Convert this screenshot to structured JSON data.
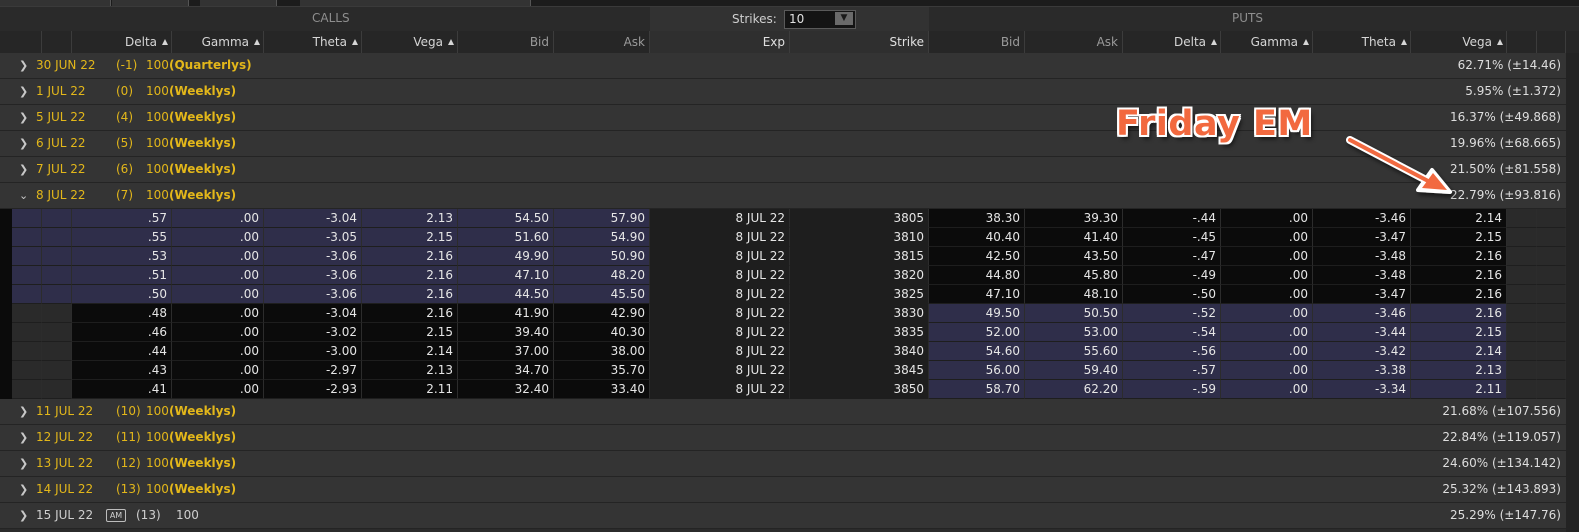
{
  "sections": {
    "calls": "CALLS",
    "puts": "PUTS",
    "strikes_label": "Strikes:",
    "strikes_value": "10"
  },
  "columns": {
    "calls": [
      "Delta",
      "Gamma",
      "Theta",
      "Vega",
      "Bid",
      "Ask"
    ],
    "middle": [
      "Exp",
      "Strike"
    ],
    "puts": [
      "Bid",
      "Ask",
      "Delta",
      "Gamma",
      "Theta",
      "Vega"
    ]
  },
  "expirations_before": [
    {
      "date": "30 JUN 22",
      "days": "(-1)",
      "mult": "100",
      "kind": "(Quarterlys)",
      "em": "62.71% (±14.46)"
    },
    {
      "date": "1 JUL 22",
      "days": "(0)",
      "mult": "100",
      "kind": "(Weeklys)",
      "em": "5.95% (±1.372)"
    },
    {
      "date": "5 JUL 22",
      "days": "(4)",
      "mult": "100",
      "kind": "(Weeklys)",
      "em": "16.37% (±49.868)"
    },
    {
      "date": "6 JUL 22",
      "days": "(5)",
      "mult": "100",
      "kind": "(Weeklys)",
      "em": "19.96% (±68.665)"
    },
    {
      "date": "7 JUL 22",
      "days": "(6)",
      "mult": "100",
      "kind": "(Weeklys)",
      "em": "21.50% (±81.558)"
    }
  ],
  "expanded": {
    "date": "8 JUL 22",
    "days": "(7)",
    "mult": "100",
    "kind": "(Weeklys)",
    "em": "22.79% (±93.816)"
  },
  "chain": [
    {
      "c_delta": ".57",
      "c_gamma": ".00",
      "c_theta": "-3.04",
      "c_vega": "2.13",
      "c_bid": "54.50",
      "c_ask": "57.90",
      "exp": "8 JUL 22",
      "strike": "3805",
      "p_bid": "38.30",
      "p_ask": "39.30",
      "p_delta": "-.44",
      "p_gamma": ".00",
      "p_theta": "-3.46",
      "p_vega": "2.14"
    },
    {
      "c_delta": ".55",
      "c_gamma": ".00",
      "c_theta": "-3.05",
      "c_vega": "2.15",
      "c_bid": "51.60",
      "c_ask": "54.90",
      "exp": "8 JUL 22",
      "strike": "3810",
      "p_bid": "40.40",
      "p_ask": "41.40",
      "p_delta": "-.45",
      "p_gamma": ".00",
      "p_theta": "-3.47",
      "p_vega": "2.15"
    },
    {
      "c_delta": ".53",
      "c_gamma": ".00",
      "c_theta": "-3.06",
      "c_vega": "2.16",
      "c_bid": "49.90",
      "c_ask": "50.90",
      "exp": "8 JUL 22",
      "strike": "3815",
      "p_bid": "42.50",
      "p_ask": "43.50",
      "p_delta": "-.47",
      "p_gamma": ".00",
      "p_theta": "-3.48",
      "p_vega": "2.16"
    },
    {
      "c_delta": ".51",
      "c_gamma": ".00",
      "c_theta": "-3.06",
      "c_vega": "2.16",
      "c_bid": "47.10",
      "c_ask": "48.20",
      "exp": "8 JUL 22",
      "strike": "3820",
      "p_bid": "44.80",
      "p_ask": "45.80",
      "p_delta": "-.49",
      "p_gamma": ".00",
      "p_theta": "-3.48",
      "p_vega": "2.16"
    },
    {
      "c_delta": ".50",
      "c_gamma": ".00",
      "c_theta": "-3.06",
      "c_vega": "2.16",
      "c_bid": "44.50",
      "c_ask": "45.50",
      "exp": "8 JUL 22",
      "strike": "3825",
      "p_bid": "47.10",
      "p_ask": "48.10",
      "p_delta": "-.50",
      "p_gamma": ".00",
      "p_theta": "-3.47",
      "p_vega": "2.16"
    },
    {
      "c_delta": ".48",
      "c_gamma": ".00",
      "c_theta": "-3.04",
      "c_vega": "2.16",
      "c_bid": "41.90",
      "c_ask": "42.90",
      "exp": "8 JUL 22",
      "strike": "3830",
      "p_bid": "49.50",
      "p_ask": "50.50",
      "p_delta": "-.52",
      "p_gamma": ".00",
      "p_theta": "-3.46",
      "p_vega": "2.16"
    },
    {
      "c_delta": ".46",
      "c_gamma": ".00",
      "c_theta": "-3.02",
      "c_vega": "2.15",
      "c_bid": "39.40",
      "c_ask": "40.30",
      "exp": "8 JUL 22",
      "strike": "3835",
      "p_bid": "52.00",
      "p_ask": "53.00",
      "p_delta": "-.54",
      "p_gamma": ".00",
      "p_theta": "-3.44",
      "p_vega": "2.15"
    },
    {
      "c_delta": ".44",
      "c_gamma": ".00",
      "c_theta": "-3.00",
      "c_vega": "2.14",
      "c_bid": "37.00",
      "c_ask": "38.00",
      "exp": "8 JUL 22",
      "strike": "3840",
      "p_bid": "54.60",
      "p_ask": "55.60",
      "p_delta": "-.56",
      "p_gamma": ".00",
      "p_theta": "-3.42",
      "p_vega": "2.14"
    },
    {
      "c_delta": ".43",
      "c_gamma": ".00",
      "c_theta": "-2.97",
      "c_vega": "2.13",
      "c_bid": "34.70",
      "c_ask": "35.70",
      "exp": "8 JUL 22",
      "strike": "3845",
      "p_bid": "56.00",
      "p_ask": "59.40",
      "p_delta": "-.57",
      "p_gamma": ".00",
      "p_theta": "-3.38",
      "p_vega": "2.13"
    },
    {
      "c_delta": ".41",
      "c_gamma": ".00",
      "c_theta": "-2.93",
      "c_vega": "2.11",
      "c_bid": "32.40",
      "c_ask": "33.40",
      "exp": "8 JUL 22",
      "strike": "3850",
      "p_bid": "58.70",
      "p_ask": "62.20",
      "p_delta": "-.59",
      "p_gamma": ".00",
      "p_theta": "-3.34",
      "p_vega": "2.11"
    }
  ],
  "expirations_after": [
    {
      "date": "11 JUL 22",
      "days": "(10)",
      "mult": "100",
      "kind": "(Weeklys)",
      "em": "21.68% (±107.556)"
    },
    {
      "date": "12 JUL 22",
      "days": "(11)",
      "mult": "100",
      "kind": "(Weeklys)",
      "em": "22.84% (±119.057)"
    },
    {
      "date": "13 JUL 22",
      "days": "(12)",
      "mult": "100",
      "kind": "(Weeklys)",
      "em": "24.60% (±134.142)"
    },
    {
      "date": "14 JUL 22",
      "days": "(13)",
      "mult": "100",
      "kind": "(Weeklys)",
      "em": "25.32% (±143.893)"
    }
  ],
  "last_row": {
    "date": "15 JUL 22",
    "badge": "AM",
    "days": "(13)",
    "mult": "100",
    "em": "25.29% (±147.76)"
  },
  "annotation": {
    "text": "Friday EM",
    "color": "#f2693f"
  },
  "colors": {
    "accent_gold": "#e3b71a",
    "itm_row": "#2f2e4a",
    "otm_row": "#0b0b0b"
  }
}
